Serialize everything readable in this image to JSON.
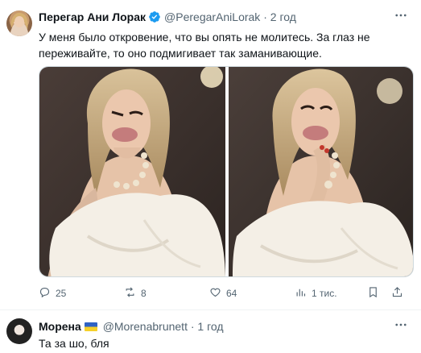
{
  "tweet": {
    "display_name": "Перегар Ани Лорак",
    "handle": "@PeregarAniLorak",
    "separator": "·",
    "time": "2 год",
    "text": "У меня было откровение, что вы опять не молитесь. За глаз не переживайте, то оно подмигивает так заманивающие.",
    "actions": {
      "replies": "25",
      "reposts": "8",
      "likes": "64",
      "views": "1 тис."
    }
  },
  "reply": {
    "display_name": "Морена",
    "handle": "@Morenabrunett",
    "separator": "·",
    "time": "1 год",
    "text": "Та за шо, бля"
  },
  "colors": {
    "verified": "#1d9bf0",
    "secondary_text": "#536471",
    "divider": "#eff3f4"
  },
  "icons": [
    "verified-badge-icon",
    "more-icon",
    "reply-icon",
    "repost-icon",
    "like-icon",
    "views-icon",
    "bookmark-icon",
    "share-icon",
    "ukraine-flag-icon"
  ]
}
